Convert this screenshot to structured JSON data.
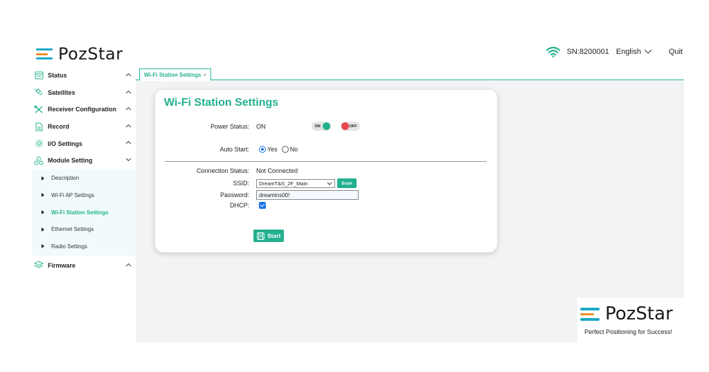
{
  "header": {
    "logo_text": "PozStar",
    "serial": "SN:8200001",
    "language": "English",
    "quit_label": "Quit"
  },
  "sidebar": {
    "items": [
      {
        "label": "Status",
        "icon": "status-icon",
        "expanded": false
      },
      {
        "label": "Satellites",
        "icon": "satellite-icon",
        "expanded": false
      },
      {
        "label": "Receiver Configuration",
        "icon": "tools-icon",
        "expanded": false
      },
      {
        "label": "Record",
        "icon": "record-icon",
        "expanded": false
      },
      {
        "label": "I/O Settings",
        "icon": "gear-icon",
        "expanded": false
      },
      {
        "label": "Module Setting",
        "icon": "module-icon",
        "expanded": true
      },
      {
        "label": "Firmware",
        "icon": "layers-icon",
        "expanded": false
      }
    ],
    "module_sub": [
      {
        "label": "Description",
        "active": false
      },
      {
        "label": "Wi-Fi AP Settings",
        "active": false
      },
      {
        "label": "Wi-Fi Station Settings",
        "active": true
      },
      {
        "label": "Ethernet Settings",
        "active": false
      },
      {
        "label": "Radio Settings",
        "active": false
      }
    ]
  },
  "tab": {
    "label": "Wi-Fi Station Settings",
    "close": "×"
  },
  "form": {
    "title": "Wi-Fi Station Settings",
    "power_status_label": "Power Status:",
    "power_status_value": "ON",
    "toggle_on_text": "ON",
    "toggle_off_text": "OFF",
    "auto_start_label": "Auto Start:",
    "auto_start_yes": "Yes",
    "auto_start_no": "No",
    "auto_start_selected": "Yes",
    "connection_status_label": "Connection Status:",
    "connection_status_value": "Not Connected",
    "ssid_label": "SSID:",
    "ssid_value": "DreamT&S_2F_Main",
    "scan_label": "Scan",
    "password_label": "Password:",
    "password_value": "dreamtns00!",
    "dhcp_label": "DHCP:",
    "dhcp_checked": true,
    "start_label": "Start"
  },
  "brand": {
    "name": "PozStar",
    "tagline": "Perfect Positioning for Success!"
  },
  "colors": {
    "accent": "#23b08f",
    "logo_blue": "#1ba8c6",
    "logo_orange": "#f08c2a",
    "off_red": "#e8474c"
  }
}
